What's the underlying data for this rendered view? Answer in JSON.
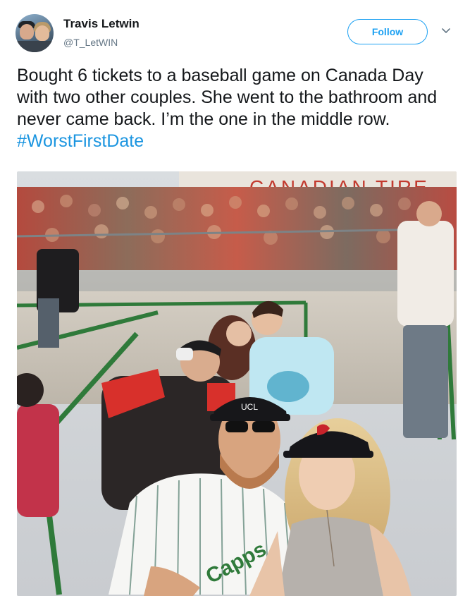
{
  "author": {
    "display_name": "Travis Letwin",
    "handle": "@T_LetWIN"
  },
  "follow_label": "Follow",
  "tweet": {
    "text": "Bought 6 tickets to a baseball game on Canada Day with two other couples. She went to the bathroom and never came back. I’m the one in the middle row. ",
    "hashtag": "#WorstFirstDate"
  },
  "photo": {
    "sign_text": "CANADIAN TIRE",
    "cap_logo": "UCL",
    "jersey_text": "Capps"
  },
  "colors": {
    "follow_blue": "#1da1f2",
    "hashtag_blue": "#1b95e0",
    "handle_gray": "#657786",
    "text_dark": "#14171a"
  },
  "icons": [
    "chevron-down-icon"
  ]
}
